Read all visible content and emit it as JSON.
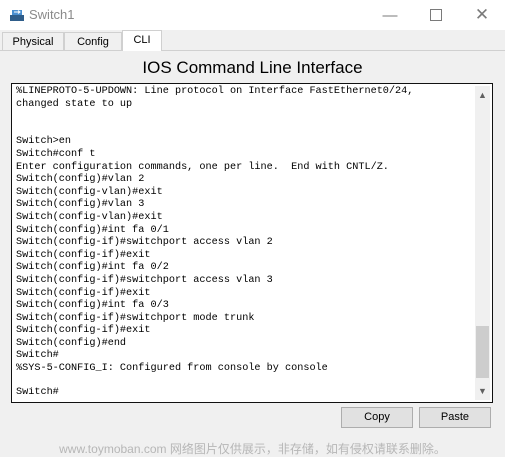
{
  "window": {
    "title": "Switch1",
    "icon": "switch-app-icon",
    "controls": [
      "minimize",
      "maximize",
      "close"
    ]
  },
  "tabs": [
    {
      "label": "Physical",
      "active": false
    },
    {
      "label": "Config",
      "active": false
    },
    {
      "label": "CLI",
      "active": true
    }
  ],
  "heading": "IOS Command Line Interface",
  "console": {
    "output": "%LINEPROTO-5-UPDOWN: Line protocol on Interface FastEthernet0/24,\nchanged state to up\n\n\nSwitch>en\nSwitch#conf t\nEnter configuration commands, one per line.  End with CNTL/Z.\nSwitch(config)#vlan 2\nSwitch(config-vlan)#exit\nSwitch(config)#vlan 3\nSwitch(config-vlan)#exit\nSwitch(config)#int fa 0/1\nSwitch(config-if)#switchport access vlan 2\nSwitch(config-if)#exit\nSwitch(config)#int fa 0/2\nSwitch(config-if)#switchport access vlan 3\nSwitch(config-if)#exit\nSwitch(config)#int fa 0/3\nSwitch(config-if)#switchport mode trunk\nSwitch(config-if)#exit\nSwitch(config)#end\nSwitch#\n%SYS-5-CONFIG_I: Configured from console by console",
    "prompt": "Switch#"
  },
  "buttons": {
    "copy": "Copy",
    "paste": "Paste"
  },
  "watermark": "www.toymoban.com 网络图片仅供展示，非存储，如有侵权请联系删除。"
}
